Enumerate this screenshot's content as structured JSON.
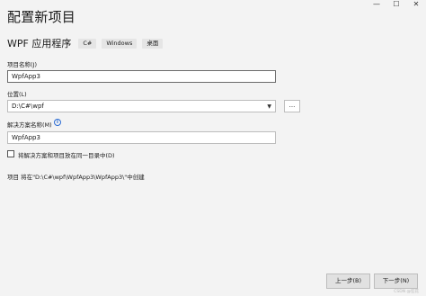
{
  "window": {
    "controls": [
      "—",
      "☐",
      "✕"
    ]
  },
  "header": {
    "title": "配置新项目"
  },
  "template": {
    "name": "WPF 应用程序",
    "tags": [
      "C#",
      "Windows",
      "桌面"
    ]
  },
  "form": {
    "project_name_label": "项目名称(J)",
    "project_name_value": "WpfApp3",
    "location_label": "位置(L)",
    "location_value": "D:\\C#\\wpf",
    "browse_label": "...",
    "solution_name_label": "解决方案名称(M)",
    "solution_name_value": "WpfApp3",
    "same_dir_label": "将解决方案和项目放在同一目录中(D)",
    "same_dir_checked": false,
    "path_note": "项目 将在\"D:\\C#\\wpf\\WpfApp3\\WpfApp3\\\"中创建"
  },
  "footer": {
    "back_label": "上一步(B)",
    "next_label": "下一步(N)",
    "watermark": "CSDN @狂花"
  }
}
